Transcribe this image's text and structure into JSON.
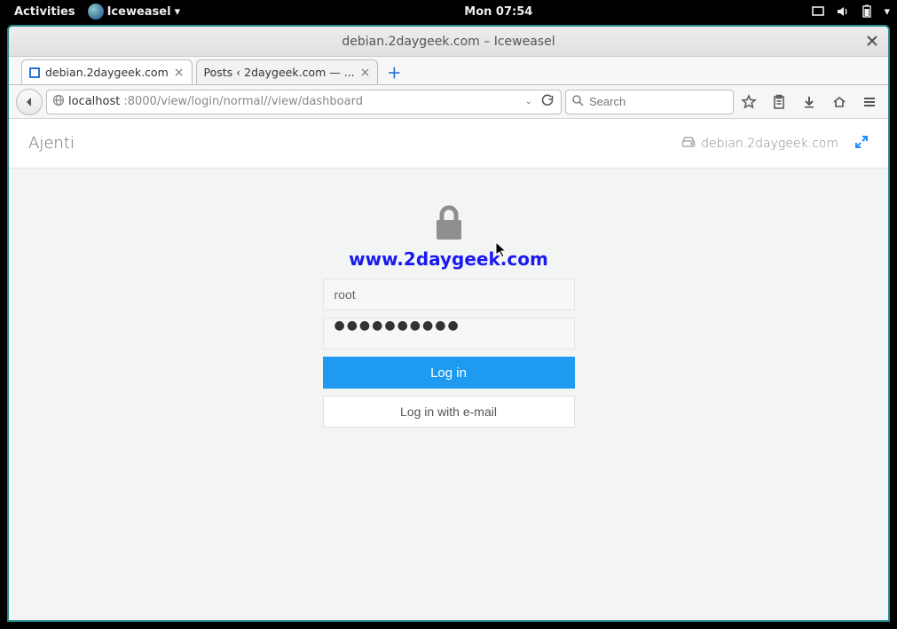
{
  "gnome": {
    "activities": "Activities",
    "app_name": "Iceweasel",
    "clock": "Mon 07:54"
  },
  "window": {
    "title": "debian.2daygeek.com – Iceweasel"
  },
  "tabs": [
    {
      "label": "debian.2daygeek.com"
    },
    {
      "label": "Posts ‹ 2daygeek.com — ..."
    }
  ],
  "url": {
    "host": "localhost",
    "path": ":8000/view/login/normal//view/dashboard"
  },
  "search": {
    "placeholder": "Search"
  },
  "ajenti": {
    "brand": "Ajenti",
    "hostname": "debian.2daygeek.com",
    "watermark": "www.2daygeek.com",
    "username": "root",
    "password_mask": "●●●●●●●●●●",
    "login_btn": "Log in",
    "email_btn": "Log in with e-mail"
  }
}
